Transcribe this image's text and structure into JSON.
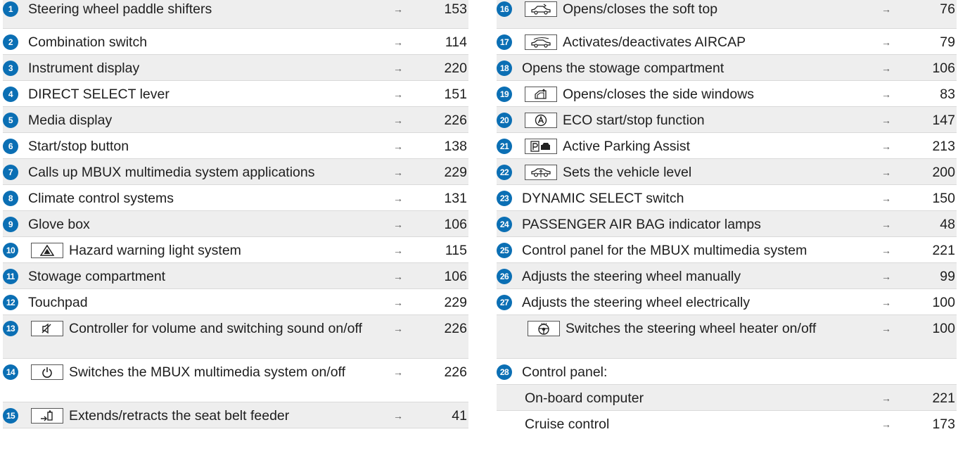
{
  "left": [
    {
      "n": "1",
      "icon": null,
      "text": "Steering wheel paddle shifters",
      "arrow": "→",
      "page": "153"
    },
    {
      "n": "2",
      "icon": null,
      "text": "Combination switch",
      "arrow": "→",
      "page": "114"
    },
    {
      "n": "3",
      "icon": null,
      "text": "Instrument display",
      "arrow": "→",
      "page": "220"
    },
    {
      "n": "4",
      "icon": null,
      "text": "DIRECT SELECT lever",
      "arrow": "→",
      "page": "151"
    },
    {
      "n": "5",
      "icon": null,
      "text": "Media display",
      "arrow": "→",
      "page": "226"
    },
    {
      "n": "6",
      "icon": null,
      "text": "Start/stop button",
      "arrow": "→",
      "page": "138"
    },
    {
      "n": "7",
      "icon": null,
      "text": "Calls up MBUX multimedia system applications",
      "arrow": "→",
      "page": "229"
    },
    {
      "n": "8",
      "icon": null,
      "text": "Climate control systems",
      "arrow": "→",
      "page": "131"
    },
    {
      "n": "9",
      "icon": null,
      "text": "Glove box",
      "arrow": "→",
      "page": "106"
    },
    {
      "n": "10",
      "icon": "hazard-warning-icon",
      "text": "Hazard warning light system",
      "arrow": "→",
      "page": "115"
    },
    {
      "n": "11",
      "icon": null,
      "text": "Stowage compartment",
      "arrow": "→",
      "page": "106"
    },
    {
      "n": "12",
      "icon": null,
      "text": "Touchpad",
      "arrow": "→",
      "page": "229"
    },
    {
      "n": "13",
      "icon": "mute-speaker-icon",
      "text": "Controller for volume and switching sound on/off",
      "arrow": "→",
      "page": "226"
    },
    {
      "n": "14",
      "icon": "power-icon",
      "text": "Switches the MBUX multimedia system on/off",
      "arrow": "→",
      "page": "226"
    },
    {
      "n": "15",
      "icon": "seat-belt-feeder-icon",
      "text": "Extends/retracts the seat belt feeder",
      "arrow": "→",
      "page": "41"
    }
  ],
  "right": [
    {
      "n": "16",
      "icon": "soft-top-icon",
      "text": "Opens/closes the soft top",
      "arrow": "→",
      "page": "76"
    },
    {
      "n": "17",
      "icon": "aircap-icon",
      "text": "Activates/deactivates AIRCAP",
      "arrow": "→",
      "page": "79"
    },
    {
      "n": "18",
      "icon": null,
      "text": "Opens the stowage compartment",
      "arrow": "→",
      "page": "106"
    },
    {
      "n": "19",
      "icon": "side-windows-icon",
      "text": "Opens/closes the side windows",
      "arrow": "→",
      "page": "83"
    },
    {
      "n": "20",
      "icon": "eco-start-stop-icon",
      "text": "ECO start/stop function",
      "arrow": "→",
      "page": "147"
    },
    {
      "n": "21",
      "icon": "parking-assist-icon",
      "text": "Active Parking Assist",
      "arrow": "→",
      "page": "213"
    },
    {
      "n": "22",
      "icon": "vehicle-level-icon",
      "text": "Sets the vehicle level",
      "arrow": "→",
      "page": "200"
    },
    {
      "n": "23",
      "icon": null,
      "text": "DYNAMIC SELECT switch",
      "arrow": "→",
      "page": "150"
    },
    {
      "n": "24",
      "icon": null,
      "text": "PASSENGER AIR BAG indicator lamps",
      "arrow": "→",
      "page": "48"
    },
    {
      "n": "25",
      "icon": null,
      "text": "Control panel for the MBUX multimedia system",
      "arrow": "→",
      "page": "221"
    },
    {
      "n": "26",
      "icon": null,
      "text": "Adjusts the steering wheel manually",
      "arrow": "→",
      "page": "99"
    },
    {
      "n": "27",
      "icon": null,
      "text": "Adjusts the steering wheel electrically",
      "arrow": "→",
      "page": "100"
    },
    {
      "n": "",
      "icon": "steering-heater-icon",
      "text": "Switches the steering wheel heater on/off",
      "arrow": "→",
      "page": "100"
    },
    {
      "n": "28",
      "icon": null,
      "text": "Control panel:",
      "arrow": "",
      "page": ""
    },
    {
      "n": "",
      "icon": null,
      "text": "On-board computer",
      "arrow": "→",
      "page": "221"
    },
    {
      "n": "",
      "icon": null,
      "text": "Cruise control",
      "arrow": "→",
      "page": "173"
    }
  ]
}
